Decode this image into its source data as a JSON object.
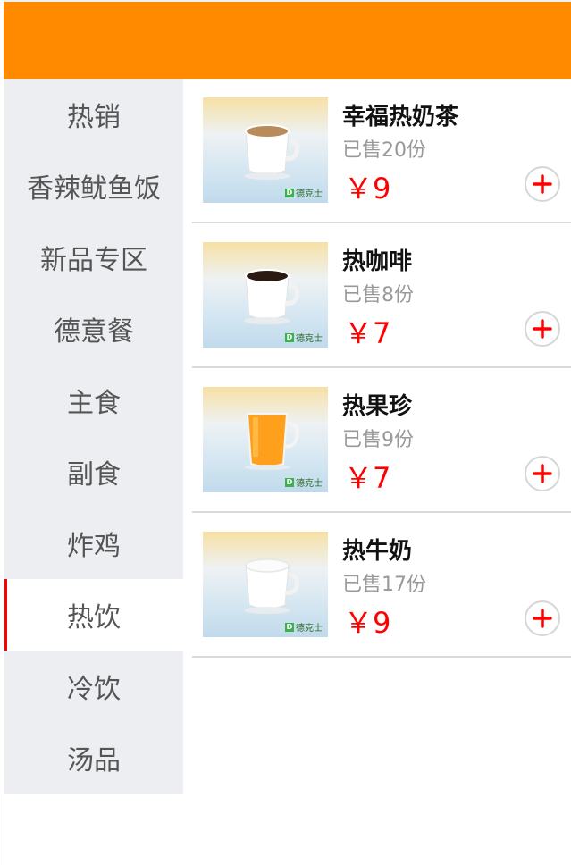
{
  "theme": {
    "header_color": "#ff8a00",
    "price_color": "#ff0000",
    "active_indicator_color": "#ff0000"
  },
  "sidebar": {
    "items": [
      {
        "label": "热销"
      },
      {
        "label": "香辣鱿鱼饭"
      },
      {
        "label": "新品专区"
      },
      {
        "label": "德意餐"
      },
      {
        "label": "主食"
      },
      {
        "label": "副食"
      },
      {
        "label": "炸鸡"
      },
      {
        "label": "热饮"
      },
      {
        "label": "冷饮"
      },
      {
        "label": "汤品"
      }
    ],
    "active_label": "热饮"
  },
  "products": [
    {
      "name": "幸福热奶茶",
      "sold": "已售20份",
      "price": "￥9",
      "drink": "milk-tea",
      "liquid_color": "#b98a5a",
      "brand": "德克士",
      "icon": "plus-icon"
    },
    {
      "name": "热咖啡",
      "sold": "已售8份",
      "price": "￥7",
      "drink": "coffee",
      "liquid_color": "#2b1a12",
      "brand": "德克士",
      "icon": "plus-icon"
    },
    {
      "name": "热果珍",
      "sold": "已售9份",
      "price": "￥7",
      "drink": "orange-drink",
      "liquid_color": "#ff9a1a",
      "brand": "德克士",
      "icon": "plus-icon"
    },
    {
      "name": "热牛奶",
      "sold": "已售17份",
      "price": "￥9",
      "drink": "milk",
      "liquid_color": "#fbfbfb",
      "brand": "德克士",
      "icon": "plus-icon"
    }
  ]
}
